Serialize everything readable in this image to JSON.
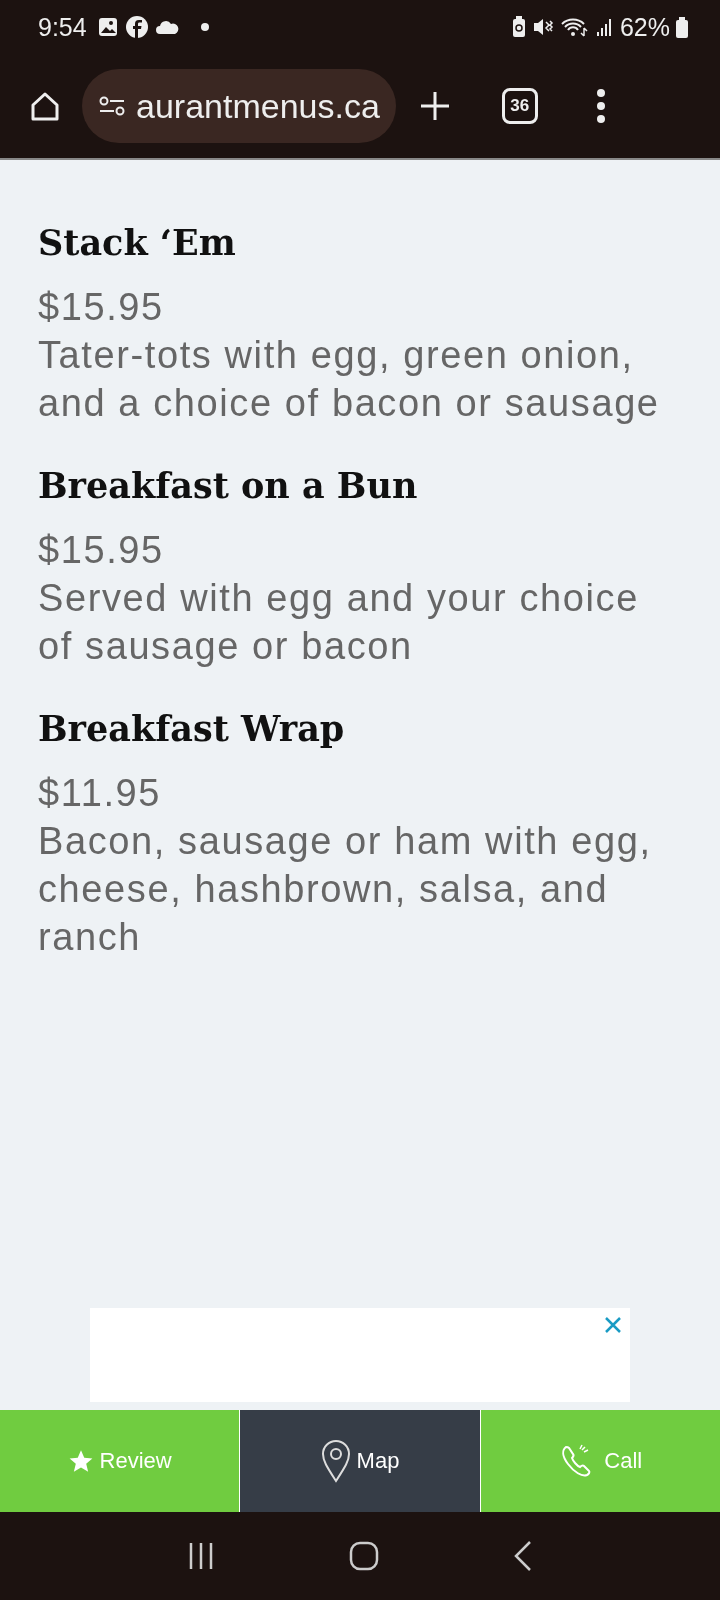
{
  "status_bar": {
    "time": "9:54",
    "battery": "62%"
  },
  "browser": {
    "url": "aurantmenus.ca",
    "tab_count": "36"
  },
  "menu_items": [
    {
      "name": "Stack ‘Em",
      "price": "$15.95",
      "description": "Tater-tots with egg, green onion, and a choice of bacon or sausage"
    },
    {
      "name": "Breakfast on a Bun",
      "price": "$15.95",
      "description": "Served with egg and your choice of sausage or bacon"
    },
    {
      "name": "Breakfast Wrap",
      "price": "$11.95",
      "description": "Bacon, sausage or ham with egg, cheese, hashbrown, salsa, and ranch"
    }
  ],
  "action_bar": [
    {
      "kind": "review",
      "label": "Review",
      "selected": false
    },
    {
      "kind": "map",
      "label": "Map",
      "selected": true
    },
    {
      "kind": "call",
      "label": "Call",
      "selected": false
    }
  ]
}
